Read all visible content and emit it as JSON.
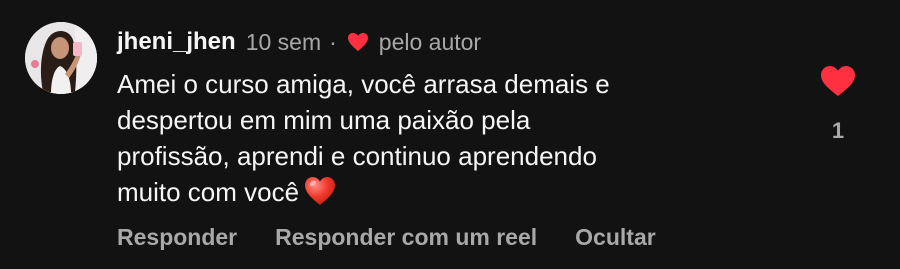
{
  "comment": {
    "username": "jheni_jhen",
    "time": "10 sem",
    "separator": "·",
    "author_like_label": "pelo autor",
    "text_lines": [
      "Amei o curso amiga, você arrasa demais e",
      "despertou em mim uma paixão pela",
      "profissão, aprendi e continuo aprendendo",
      "muito com você"
    ],
    "like_count": "1",
    "actions": {
      "reply": "Responder",
      "reply_reel": "Responder com um reel",
      "hide": "Ocultar"
    },
    "icons": {
      "author_heart": "heart-icon",
      "inline_emoji": "red-heart-emoji",
      "like": "heart-icon"
    },
    "colors": {
      "background": "#121212",
      "heart": "#ff3040",
      "muted": "#a8a8a8",
      "text": "#f5f5f5"
    }
  }
}
